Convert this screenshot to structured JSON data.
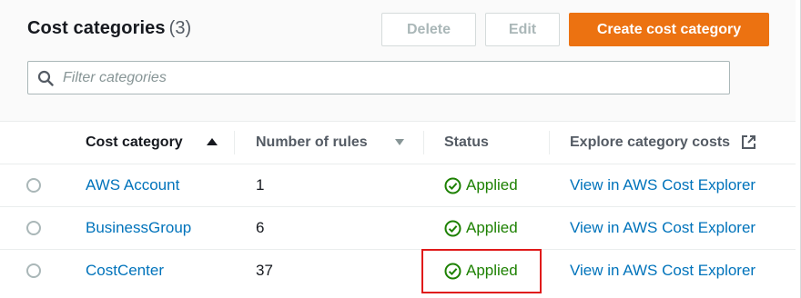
{
  "header": {
    "title": "Cost categories",
    "count": "(3)",
    "delete_label": "Delete",
    "edit_label": "Edit",
    "create_label": "Create cost category"
  },
  "filter": {
    "placeholder": "Filter categories",
    "value": ""
  },
  "table": {
    "columns": {
      "category": "Cost category",
      "rules": "Number of rules",
      "status": "Status",
      "explore": "Explore category costs"
    },
    "rows": [
      {
        "name": "AWS Account",
        "rules": "1",
        "status": "Applied",
        "explore": "View in AWS Cost Explorer"
      },
      {
        "name": "BusinessGroup",
        "rules": "6",
        "status": "Applied",
        "explore": "View in AWS Cost Explorer"
      },
      {
        "name": "CostCenter",
        "rules": "37",
        "status": "Applied",
        "explore": "View in AWS Cost Explorer"
      }
    ]
  },
  "colors": {
    "primary_button": "#ec7211",
    "link": "#0073bb",
    "success": "#1d8102",
    "highlight": "#e01a1a"
  },
  "icons": {
    "search": "search-icon",
    "sort_ascending": "sort-ascending-icon",
    "sort_descending": "sort-descending-icon",
    "external_link": "external-link-icon",
    "status_ok": "check-circle-icon"
  }
}
